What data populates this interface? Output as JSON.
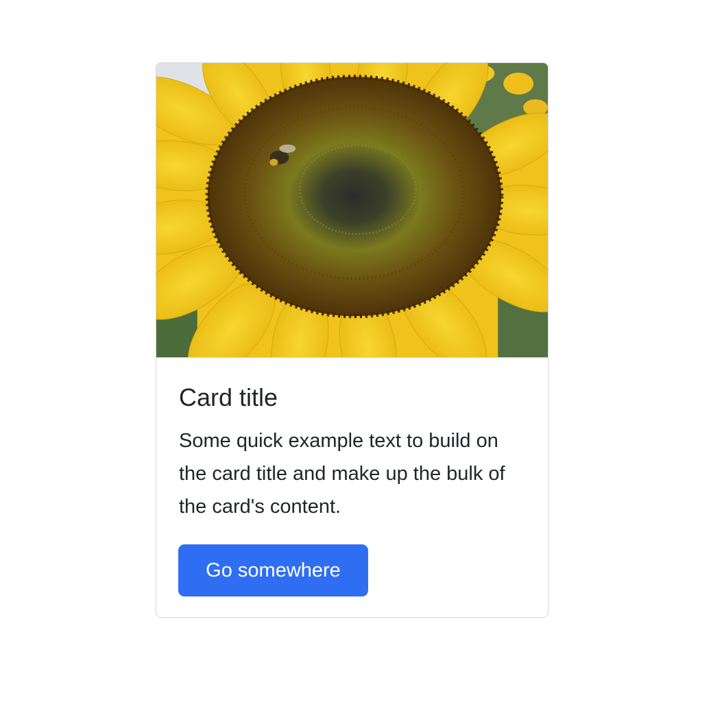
{
  "card": {
    "image_name": "sunflower-image",
    "title": "Card title",
    "text": "Some quick example text to build on the card title and make up the bulk of the card's content.",
    "button_label": "Go somewhere"
  },
  "colors": {
    "button_bg": "#2f6ef3",
    "button_text": "#ffffff",
    "text": "#212529",
    "border": "#d3d5d8"
  }
}
